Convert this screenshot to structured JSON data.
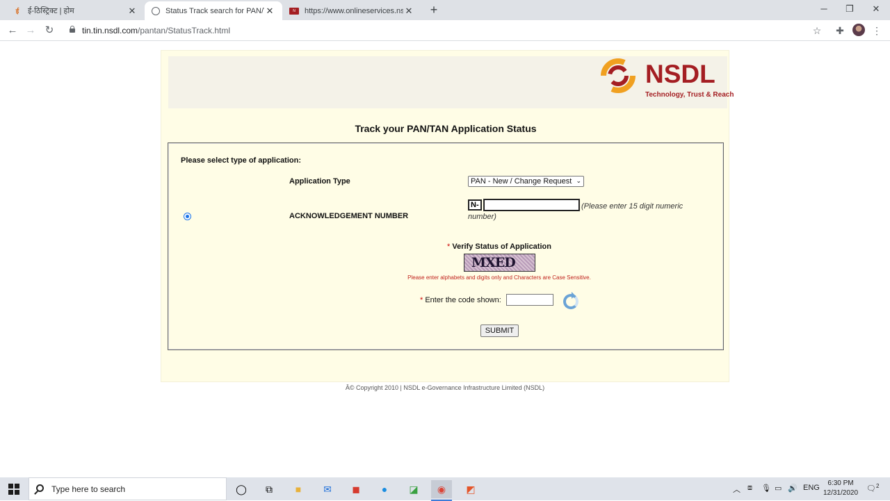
{
  "browser": {
    "tabs": [
      {
        "title": "ई-ठिस्ट्रिक्ट | होम",
        "favicon": "orange-logo-icon"
      },
      {
        "title": "Status Track search for PAN/TAN",
        "favicon": "globe-icon"
      },
      {
        "title": "https://www.onlineservices.nsdl.c",
        "favicon": "nsdl-favicon-icon"
      }
    ],
    "url_host": "tin.tin.nsdl.com",
    "url_path": "/pantan/StatusTrack.html"
  },
  "header": {
    "logo_text": "NSDL",
    "logo_tagline": "Technology, Trust & Reach"
  },
  "page": {
    "title": "Track your PAN/TAN Application Status"
  },
  "form": {
    "heading": "Please select type of application:",
    "application_type_label": "Application Type",
    "application_type_value": "PAN - New / Change Request",
    "ack_label": "ACKNOWLEDGEMENT NUMBER",
    "ack_prefix": "N-",
    "ack_value": "",
    "ack_hint": "(Please enter 15 digit numeric number)",
    "required_mark": "*",
    "verify_label": "Verify Status of Application",
    "captcha_text": "MXED",
    "case_note": "Please enter alphabets and digits only and Characters are Case Sensitive.",
    "code_label": "Enter the code shown:",
    "code_value": "",
    "submit_label": "SUBMIT"
  },
  "footer": {
    "copyright": "Â© Copyright 2010  |  NSDL e-Governance Infrastructure Limited (NSDL)"
  },
  "taskbar": {
    "search_placeholder": "Type here to search",
    "language": "ENG",
    "time": "6:30 PM",
    "date": "12/31/2020",
    "notification_count": "2"
  },
  "colors": {
    "brand_red": "#a41e22",
    "page_bg": "#fffde6",
    "note_red": "#c0211b"
  }
}
